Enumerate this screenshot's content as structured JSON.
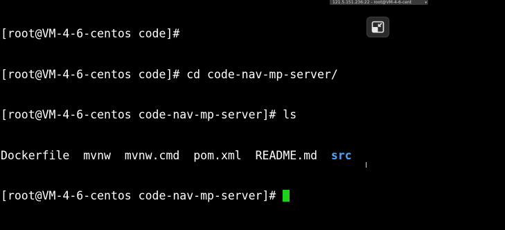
{
  "window": {
    "title_chip": "121.5.151.236:22 - root@VM-4-6-cent"
  },
  "terminal": {
    "lines": [
      "[root@VM-4-6-centos code]#",
      "[root@VM-4-6-centos code]# cd code-nav-mp-server/",
      "[root@VM-4-6-centos code-nav-mp-server]# ls"
    ],
    "ls_output": {
      "files": [
        "Dockerfile",
        "mvnw",
        "mvnw.cmd",
        "pom.xml",
        "README.md"
      ],
      "directories": [
        "src"
      ]
    },
    "prompt": "[root@VM-4-6-centos code-nav-mp-server]#"
  },
  "colors": {
    "background": "#000000",
    "text": "#ffffff",
    "directory": "#4aa8ff",
    "cursor": "#1dd21d"
  },
  "icons": {
    "restore_button": "exit-fullscreen-icon",
    "pointer": "i-beam-cursor-icon"
  }
}
